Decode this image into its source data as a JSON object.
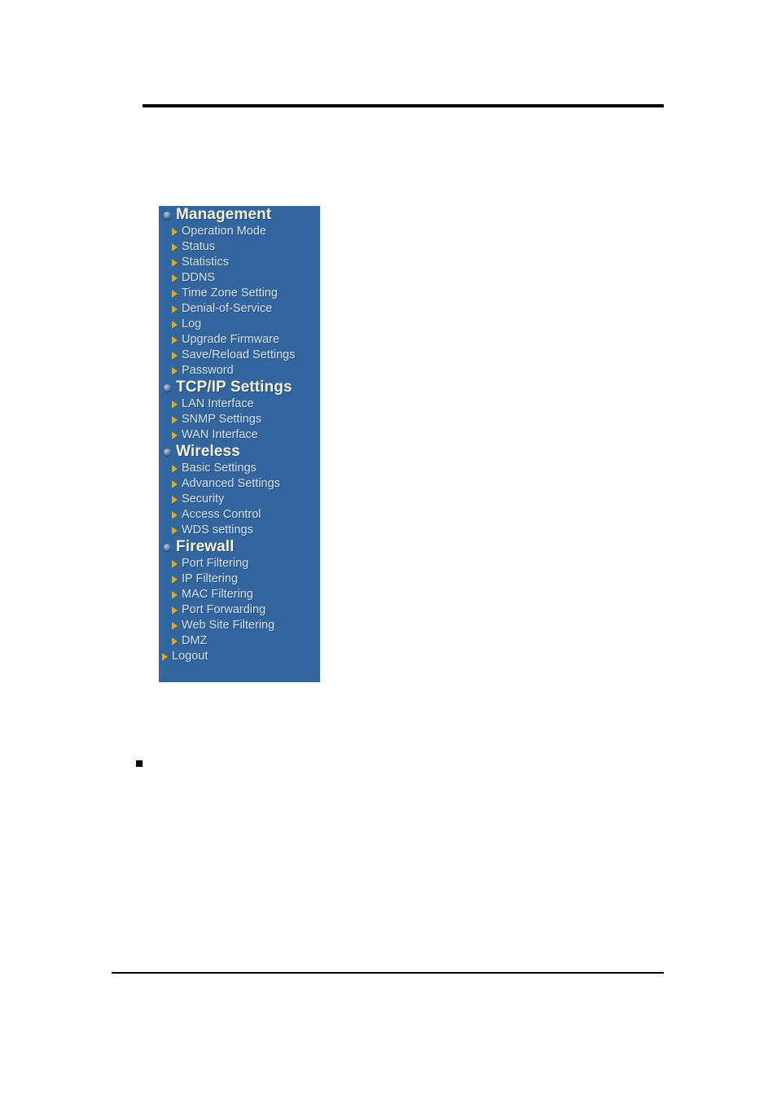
{
  "page": {
    "background_color": "#ffffff",
    "rule_color": "#000000",
    "body_bullet": "■"
  },
  "menu": {
    "panel_background": "#33669E",
    "section_title_color": "#F2F2DC",
    "item_text_color": "#D6E2F0",
    "arrow_color": "#F0A500",
    "sections": [
      {
        "title": "Management",
        "icon": "sphere-bullet-icon",
        "items": [
          {
            "label": "Operation Mode"
          },
          {
            "label": "Status"
          },
          {
            "label": "Statistics"
          },
          {
            "label": "DDNS"
          },
          {
            "label": "Time Zone Setting"
          },
          {
            "label": "Denial-of-Service"
          },
          {
            "label": "Log"
          },
          {
            "label": "Upgrade Firmware"
          },
          {
            "label": "Save/Reload Settings"
          },
          {
            "label": "Password"
          }
        ]
      },
      {
        "title": "TCP/IP Settings",
        "icon": "sphere-bullet-icon",
        "items": [
          {
            "label": "LAN Interface"
          },
          {
            "label": "SNMP Settings"
          },
          {
            "label": "WAN Interface"
          }
        ]
      },
      {
        "title": "Wireless",
        "icon": "sphere-bullet-icon",
        "items": [
          {
            "label": "Basic Settings"
          },
          {
            "label": "Advanced Settings"
          },
          {
            "label": "Security"
          },
          {
            "label": "Access Control"
          },
          {
            "label": "WDS settings"
          }
        ]
      },
      {
        "title": "Firewall",
        "icon": "sphere-bullet-icon",
        "items": [
          {
            "label": "Port Filtering"
          },
          {
            "label": "IP Filtering"
          },
          {
            "label": "MAC Filtering"
          },
          {
            "label": "Port Forwarding"
          },
          {
            "label": "Web Site Filtering"
          },
          {
            "label": "DMZ"
          }
        ]
      }
    ],
    "standalone_items": [
      {
        "label": "Logout"
      }
    ]
  }
}
